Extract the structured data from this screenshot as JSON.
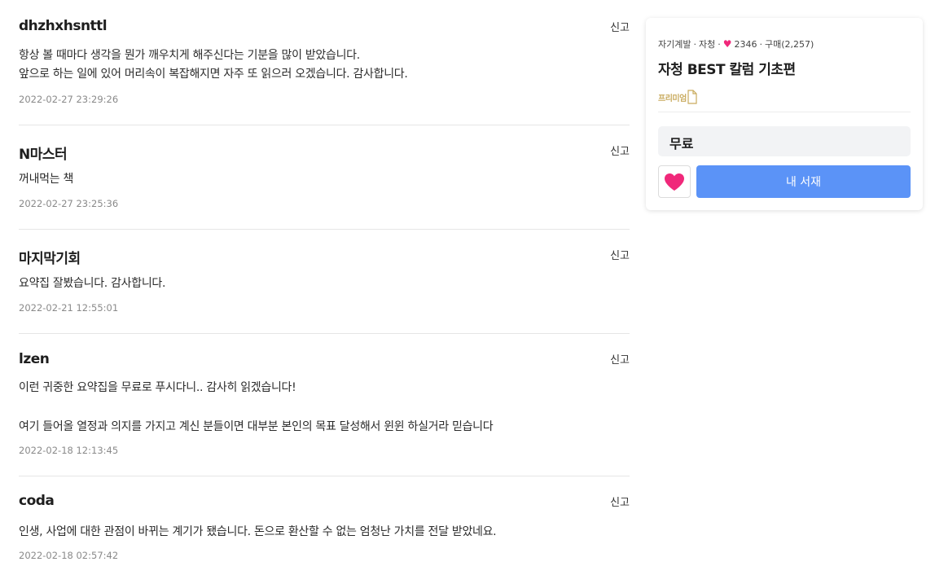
{
  "reviews": [
    {
      "author": "dhzhxhsnttl",
      "report": "신고",
      "text": "항상 볼 때마다 생각을 뭔가 깨우치게 해주신다는 기분을 많이 받았습니다.\n앞으로 하는 일에 있어 머리속이 복잡해지면 자주 또 읽으러 오겠습니다. 감사합니다.",
      "date": "2022-02-27 23:29:26"
    },
    {
      "author": "N마스터",
      "report": "신고",
      "text": "꺼내먹는 책",
      "date": "2022-02-27 23:25:36"
    },
    {
      "author": "마지막기회",
      "report": "신고",
      "text": "요약집 잘봤습니다. 감사합니다.",
      "date": "2022-02-21 12:55:01"
    },
    {
      "author": "lzen",
      "report": "신고",
      "text": "이런 귀중한 요약집을 무료로 푸시다니.. 감사히 읽겠습니다!\n\n여기 들어올 열정과 의지를 가지고 계신 분들이면 대부분 본인의 목표 달성해서 윈윈 하실거라 믿습니다",
      "date": "2022-02-18 12:13:45"
    },
    {
      "author": "coda",
      "report": "신고",
      "text": "인생, 사업에 대한 관점이 바뀌는 계기가 됐습니다. 돈으로 환산할 수 없는 엄청난 가치를 전달 받았네요.",
      "date": "2022-02-18 02:57:42"
    }
  ],
  "product": {
    "category": "자기계발",
    "author": "자청",
    "likes": "2346",
    "purchases": "구매(2,257)",
    "title": "자청 BEST 칼럼 기초편",
    "badge": "프리미엄",
    "price": "무료",
    "library_button": "내 서재",
    "accent_color": "#5b93f7",
    "heart_color": "#f0287a"
  }
}
